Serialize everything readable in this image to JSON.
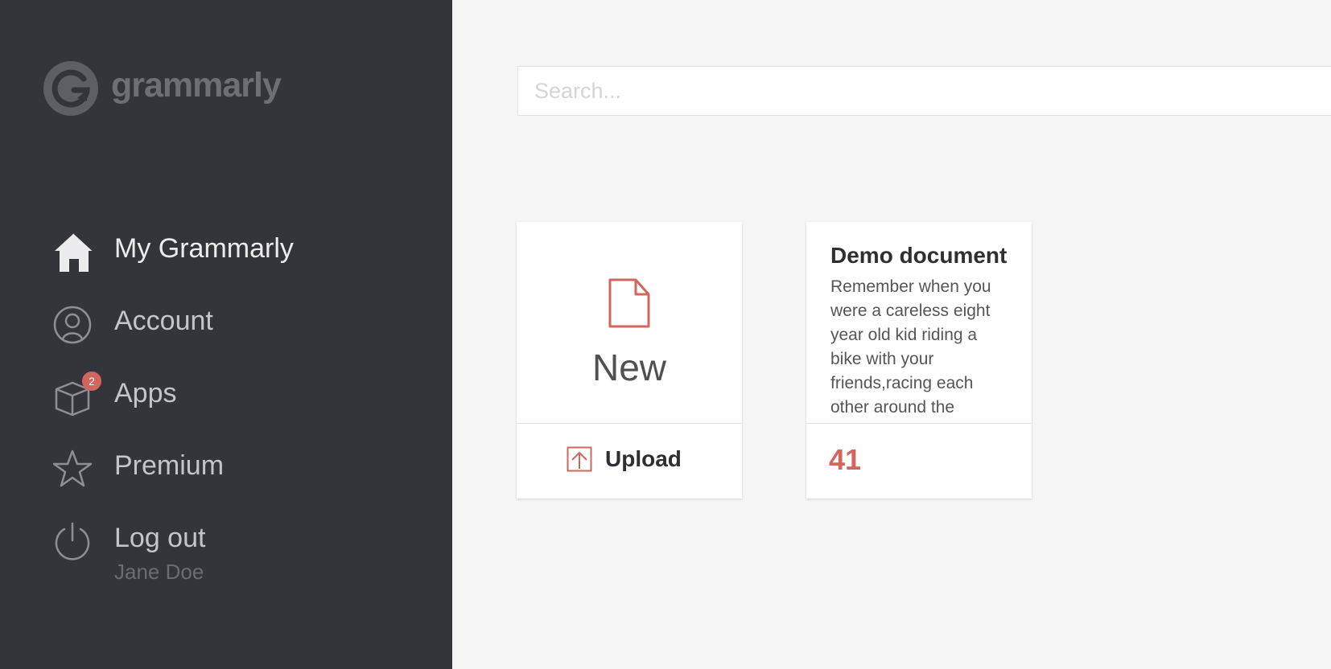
{
  "brand": {
    "name": "grammarly"
  },
  "sidebar": {
    "items": [
      {
        "label": "My Grammarly",
        "icon": "home-icon"
      },
      {
        "label": "Account",
        "icon": "user-icon"
      },
      {
        "label": "Apps",
        "icon": "cube-icon",
        "badge": "2"
      },
      {
        "label": "Premium",
        "icon": "star-icon"
      },
      {
        "label": "Log out",
        "icon": "power-icon",
        "sublabel": "Jane Doe"
      }
    ]
  },
  "search": {
    "placeholder": "Search...",
    "value": ""
  },
  "cards": {
    "new": {
      "label": "New",
      "icon": "document-icon",
      "upload_label": "Upload",
      "upload_icon": "upload-icon"
    },
    "document": {
      "title": "Demo document",
      "excerpt": "Remember when you were a careless eight year old kid riding a bike with your friends,racing each other around the",
      "score": "41"
    }
  },
  "colors": {
    "sidebar_bg": "#34353a",
    "accent": "#d2665f",
    "page_bg": "#f5f5f5"
  }
}
